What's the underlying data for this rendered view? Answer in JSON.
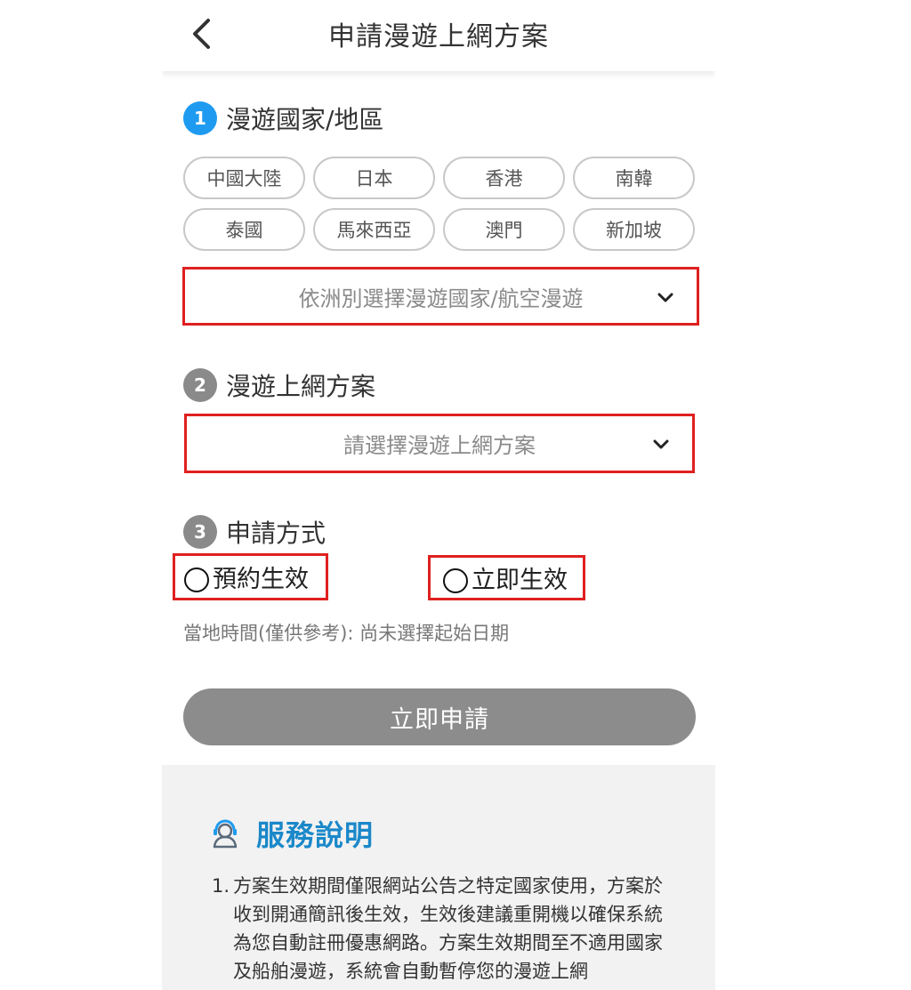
{
  "header": {
    "title": "申請漫遊上網方案"
  },
  "section1": {
    "step": "1",
    "title": "漫遊國家/地區",
    "countries": [
      "中國大陸",
      "日本",
      "香港",
      "南韓",
      "泰國",
      "馬來西亞",
      "澳門",
      "新加坡"
    ],
    "continent_select_placeholder": "依洲別選擇漫遊國家/航空漫遊"
  },
  "section2": {
    "step": "2",
    "title": "漫遊上網方案",
    "plan_select_placeholder": "請選擇漫遊上網方案"
  },
  "section3": {
    "step": "3",
    "title": "申請方式",
    "option_scheduled": "預約生效",
    "option_immediate": "立即生效",
    "local_time": "當地時間(僅供參考): 尚未選擇起始日期"
  },
  "submit_label": "立即申請",
  "service": {
    "title": "服務說明",
    "items": [
      {
        "num": "1.",
        "text": "方案生效期間僅限網站公告之特定國家使用，方案於收到開通簡訊後生效，生效後建議重開機以確保系統為您自動註冊優惠網路。方案生效期間至不適用國家及船舶漫遊，系統會自動暫停您的漫遊上網"
      }
    ]
  },
  "colors": {
    "step_active": "#1e9bf0",
    "step_inactive": "#8a8a8a",
    "highlight_border": "#e02020",
    "submit_bg": "#8c8c8c",
    "service_title": "#1a88c9"
  }
}
